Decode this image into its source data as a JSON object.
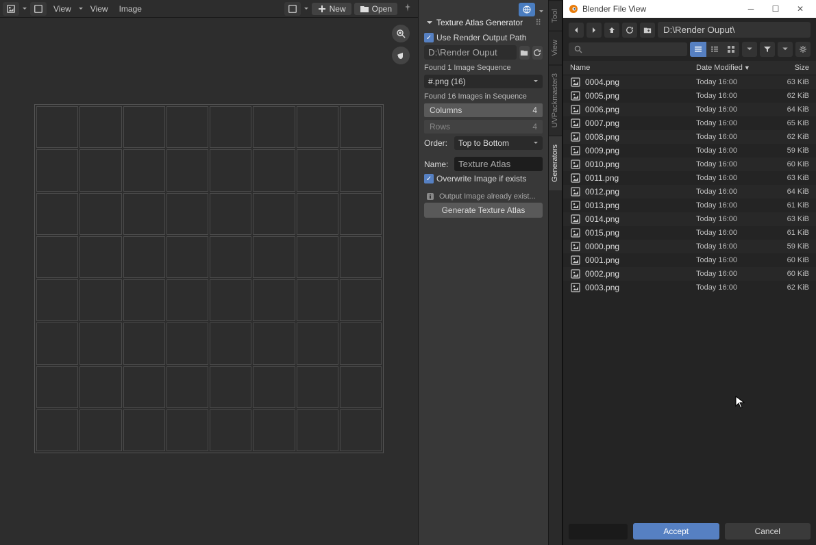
{
  "toolbar": {
    "view_dropdown": "View",
    "view_menu": "View",
    "image_menu": "Image",
    "new_button": "New",
    "open_button": "Open"
  },
  "panel": {
    "title": "Texture Atlas Generator",
    "use_render_output": "Use Render Output Path",
    "output_path": "D:\\Render Ouput",
    "found_sequence": "Found 1 Image Sequence",
    "sequence_value": "#.png (16)",
    "found_images": "Found 16 Images in Sequence",
    "columns_label": "Columns",
    "columns_value": "4",
    "rows_label": "Rows",
    "rows_value": "4",
    "order_label": "Order:",
    "order_value": "Top to Bottom",
    "name_label": "Name:",
    "name_value": "Texture Atlas",
    "overwrite_label": "Overwrite Image if exists",
    "output_info": "Output Image already exist...",
    "generate_btn": "Generate Texture Atlas"
  },
  "tabs": {
    "tool": "Tool",
    "view": "View",
    "uvpackmaster": "UVPackmaster3",
    "generators": "Generators"
  },
  "file_dialog": {
    "title": "Blender File View",
    "path": "D:\\Render Ouput\\",
    "col_name": "Name",
    "col_date": "Date Modified",
    "col_size": "Size",
    "accept": "Accept",
    "cancel": "Cancel",
    "files": [
      {
        "name": "0004.png",
        "date": "Today 16:00",
        "size": "63 KiB"
      },
      {
        "name": "0005.png",
        "date": "Today 16:00",
        "size": "62 KiB"
      },
      {
        "name": "0006.png",
        "date": "Today 16:00",
        "size": "64 KiB"
      },
      {
        "name": "0007.png",
        "date": "Today 16:00",
        "size": "65 KiB"
      },
      {
        "name": "0008.png",
        "date": "Today 16:00",
        "size": "62 KiB"
      },
      {
        "name": "0009.png",
        "date": "Today 16:00",
        "size": "59 KiB"
      },
      {
        "name": "0010.png",
        "date": "Today 16:00",
        "size": "60 KiB"
      },
      {
        "name": "0011.png",
        "date": "Today 16:00",
        "size": "63 KiB"
      },
      {
        "name": "0012.png",
        "date": "Today 16:00",
        "size": "64 KiB"
      },
      {
        "name": "0013.png",
        "date": "Today 16:00",
        "size": "61 KiB"
      },
      {
        "name": "0014.png",
        "date": "Today 16:00",
        "size": "63 KiB"
      },
      {
        "name": "0015.png",
        "date": "Today 16:00",
        "size": "61 KiB"
      },
      {
        "name": "0000.png",
        "date": "Today 16:00",
        "size": "59 KiB"
      },
      {
        "name": "0001.png",
        "date": "Today 16:00",
        "size": "60 KiB"
      },
      {
        "name": "0002.png",
        "date": "Today 16:00",
        "size": "60 KiB"
      },
      {
        "name": "0003.png",
        "date": "Today 16:00",
        "size": "62 KiB"
      }
    ]
  }
}
